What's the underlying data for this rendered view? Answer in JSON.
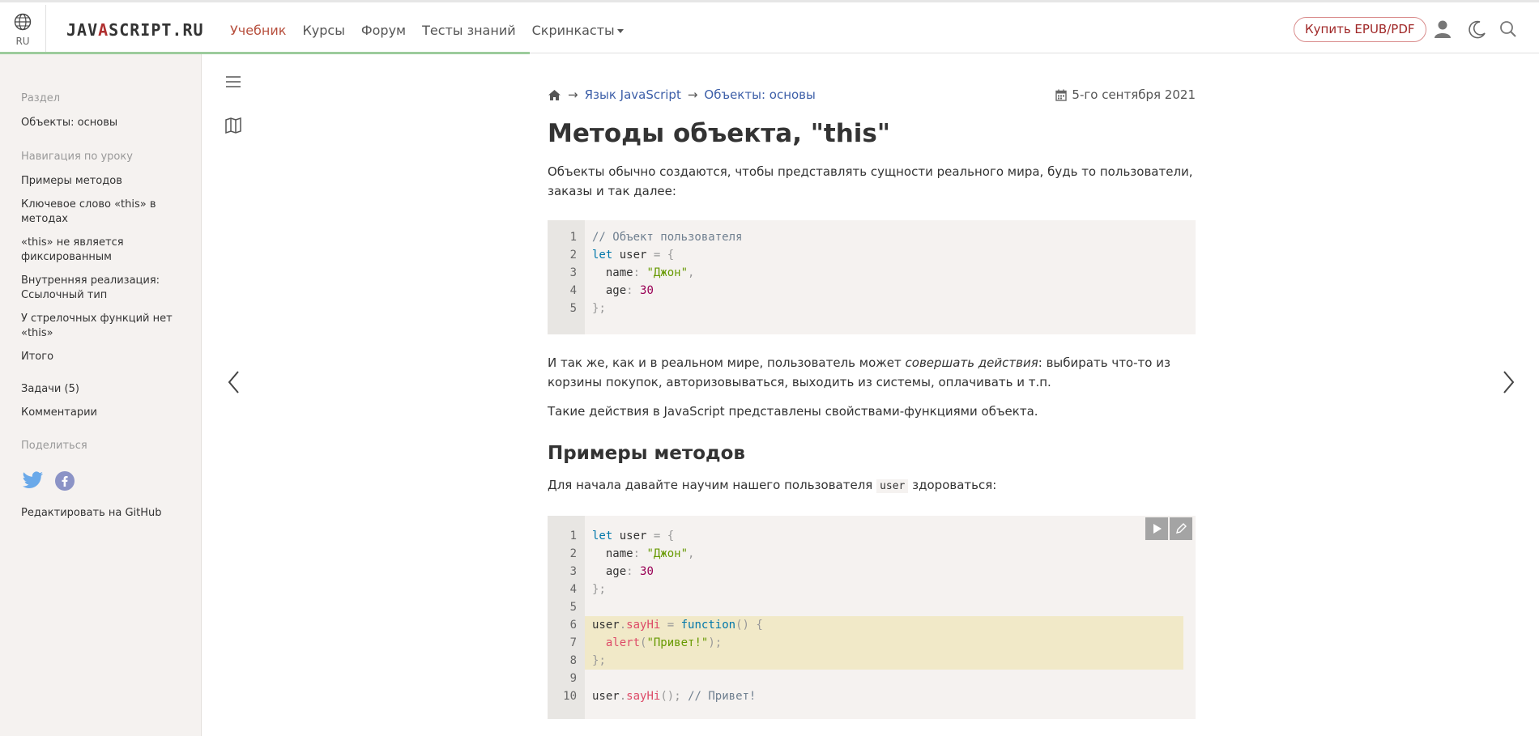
{
  "header": {
    "lang": "RU",
    "logo": {
      "before": "JAV",
      "mark": "A",
      "after": "SCRIPT.RU"
    },
    "nav": [
      {
        "label": "Учебник",
        "active": true
      },
      {
        "label": "Курсы",
        "active": false
      },
      {
        "label": "Форум",
        "active": false
      },
      {
        "label": "Тесты знаний",
        "active": false
      },
      {
        "label": "Скринкасты",
        "active": false,
        "dropdown": true
      }
    ],
    "buy_label": "Купить EPUB/PDF",
    "icons": [
      "user-icon",
      "moon-icon",
      "search-icon"
    ]
  },
  "sidebar": {
    "section_head": "Раздел",
    "section_link": "Объекты: основы",
    "nav_head": "Навигация по уроку",
    "nav_items": [
      "Примеры методов",
      "Ключевое слово «this» в методах",
      "«this» не является фиксированным",
      "Внутренняя реализация: Ссылочный тип",
      "У стрелочных функций нет «this»",
      "Итого"
    ],
    "tasks": "Задачи (5)",
    "comments": "Комментарии",
    "share_head": "Поделиться",
    "edit_github": "Редактировать на GitHub"
  },
  "breadcrumb": {
    "sep": "→",
    "items": [
      "Язык JavaScript",
      "Объекты: основы"
    ]
  },
  "date": "5-го сентября 2021",
  "article": {
    "title": "Методы объекта, \"this\"",
    "intro": "Объекты обычно создаются, чтобы представлять сущности реального мира, будь то пользователи, заказы и так далее:",
    "para2_before": "И так же, как и в реальном мире, пользователь может ",
    "para2_em": "совершать действия",
    "para2_after": ": выбирать что-то из корзины покупок, авторизовываться, выходить из системы, оплачивать и т.п.",
    "para3": "Такие действия в JavaScript представлены свойствами-функциями объекта.",
    "h2": "Примеры методов",
    "para4_before": "Для начала давайте научим нашего пользователя ",
    "para4_code": "user",
    "para4_after": " здороваться:"
  },
  "code1": [
    "// Объект пользователя",
    "let user = {",
    "  name: \"Джон\",",
    "  age: 30",
    "};"
  ],
  "code2": [
    "let user = {",
    "  name: \"Джон\",",
    "  age: 30",
    "};",
    "",
    "user.sayHi = function() {",
    "  alert(\"Привет!\");",
    "};",
    "",
    "user.sayHi(); // Привет!"
  ],
  "code2_highlight_lines": [
    6,
    7,
    8
  ],
  "colors": {
    "accent": "#b74f3d",
    "link": "#3d5fa8",
    "code_bg": "#f5f2f0",
    "highlight": "#f1e9c8"
  }
}
